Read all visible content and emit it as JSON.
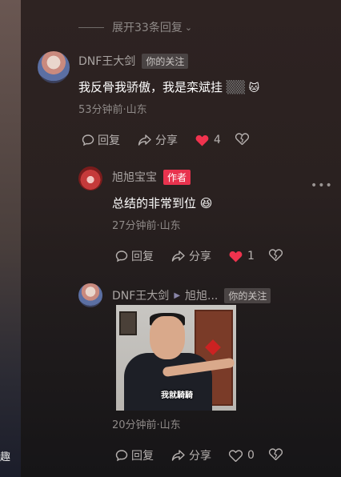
{
  "edge_char": "趣",
  "expand": {
    "label": "展开33条回复"
  },
  "comments": [
    {
      "name": "DNF王大剑",
      "tag": "你的关注",
      "text": "我反骨我骄傲，我是栾斌挂",
      "time_loc": "53分钟前·山东",
      "reply": "回复",
      "share": "分享",
      "likes": "4"
    },
    {
      "name": "旭旭宝宝",
      "tag": "作者",
      "text": "总结的非常到位",
      "time_loc": "27分钟前·山东",
      "reply": "回复",
      "share": "分享",
      "likes": "1"
    },
    {
      "name": "DNF王大剑",
      "reply_to": "旭旭...",
      "tag": "你的关注",
      "meme_caption": "我就騎騎",
      "time_loc": "20分钟前·山东",
      "reply": "回复",
      "share": "分享",
      "likes": "0"
    }
  ],
  "colors": {
    "like_active": "#f0334e",
    "author_tag": "#e8334e"
  }
}
